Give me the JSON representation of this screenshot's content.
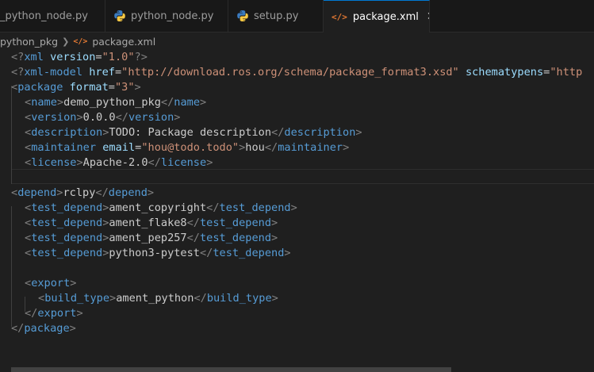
{
  "tabs": [
    {
      "label": "_python_node.py"
    },
    {
      "label": "python_node.py"
    },
    {
      "label": "setup.py"
    },
    {
      "label": "package.xml"
    }
  ],
  "breadcrumb": {
    "folder": "python_pkg",
    "file": "package.xml"
  },
  "code": {
    "xml_decl": {
      "name": "xml",
      "attr": "version",
      "value": "\"1.0\""
    },
    "xml_model": {
      "name": "xml-model",
      "href_attr": "href",
      "href_value": "\"http://download.ros.org/schema/package_format3.xsd\"",
      "schema_attr": "schematypens",
      "schema_value_partial": "\"http"
    },
    "package_open": {
      "tag": "package",
      "attr": "format",
      "value": "\"3\""
    },
    "name": {
      "tag": "name",
      "text": "demo_python_pkg"
    },
    "version": {
      "tag": "version",
      "text": "0.0.0"
    },
    "description": {
      "tag": "description",
      "text": "TODO: Package description"
    },
    "maintainer": {
      "tag": "maintainer",
      "attr": "email",
      "value": "\"hou@todo.todo\"",
      "text": "hou"
    },
    "license": {
      "tag": "license",
      "text": "Apache-2.0"
    },
    "depend": {
      "tag": "depend",
      "text": "rclpy"
    },
    "test_depends": [
      {
        "tag": "test_depend",
        "text": "ament_copyright"
      },
      {
        "tag": "test_depend",
        "text": "ament_flake8"
      },
      {
        "tag": "test_depend",
        "text": "ament_pep257"
      },
      {
        "tag": "test_depend",
        "text": "python3-pytest"
      }
    ],
    "export": {
      "tag": "export"
    },
    "build_type": {
      "tag": "build_type",
      "text": "ament_python"
    },
    "package_close": {
      "tag": "package"
    }
  },
  "colors": {
    "tag": "#569cd6",
    "attribute": "#9cdcfe",
    "string": "#ce9178",
    "punctuation": "#808080",
    "text": "#cccccc",
    "xml_icon": "#e37933",
    "active_tab_border": "#0078d4"
  },
  "icons": {
    "python": "python-icon",
    "xml": "xml-file-icon",
    "close": "close-icon",
    "chevron": "chevron-right-icon"
  }
}
